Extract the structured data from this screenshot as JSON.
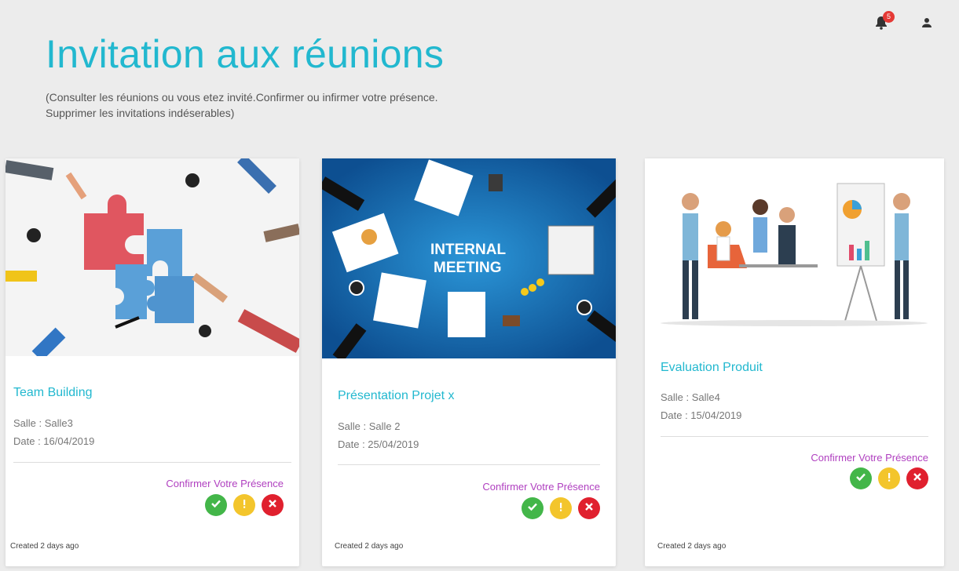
{
  "header": {
    "notification_count": "5",
    "title": "Invitation aux réunions",
    "subtitle_line1": "(Consulter les réunions ou vous etez invité.Confirmer ou infirmer votre présence.",
    "subtitle_line2": "Supprimer les invitations indéserables)"
  },
  "icons": {
    "notifications": "bell-icon",
    "profile": "user-icon",
    "confirm": "check-icon",
    "maybe": "exclamation-icon",
    "decline": "close-icon"
  },
  "colors": {
    "accent": "#22b8cf",
    "confirm_label": "#b040c0",
    "confirm": "#43b649",
    "maybe": "#f3c52c",
    "decline": "#e0202e",
    "badge": "#e53935"
  },
  "cards": [
    {
      "title": "Team Building",
      "salle": "Salle : Salle3",
      "date": "Date : 16/04/2019",
      "confirm_label": "Confirmer Votre Présence",
      "created": "Created 2 days ago"
    },
    {
      "title": "Présentation Projet x",
      "salle": "Salle : Salle 2",
      "date": "Date : 25/04/2019",
      "confirm_label": "Confirmer Votre Présence",
      "created": "Created 2 days ago",
      "image_text_line1": "INTERNAL",
      "image_text_line2": "MEETING"
    },
    {
      "title": "Evaluation Produit",
      "salle": "Salle : Salle4",
      "date": "Date : 15/04/2019",
      "confirm_label": "Confirmer Votre Présence",
      "created": "Created 2 days ago"
    }
  ]
}
